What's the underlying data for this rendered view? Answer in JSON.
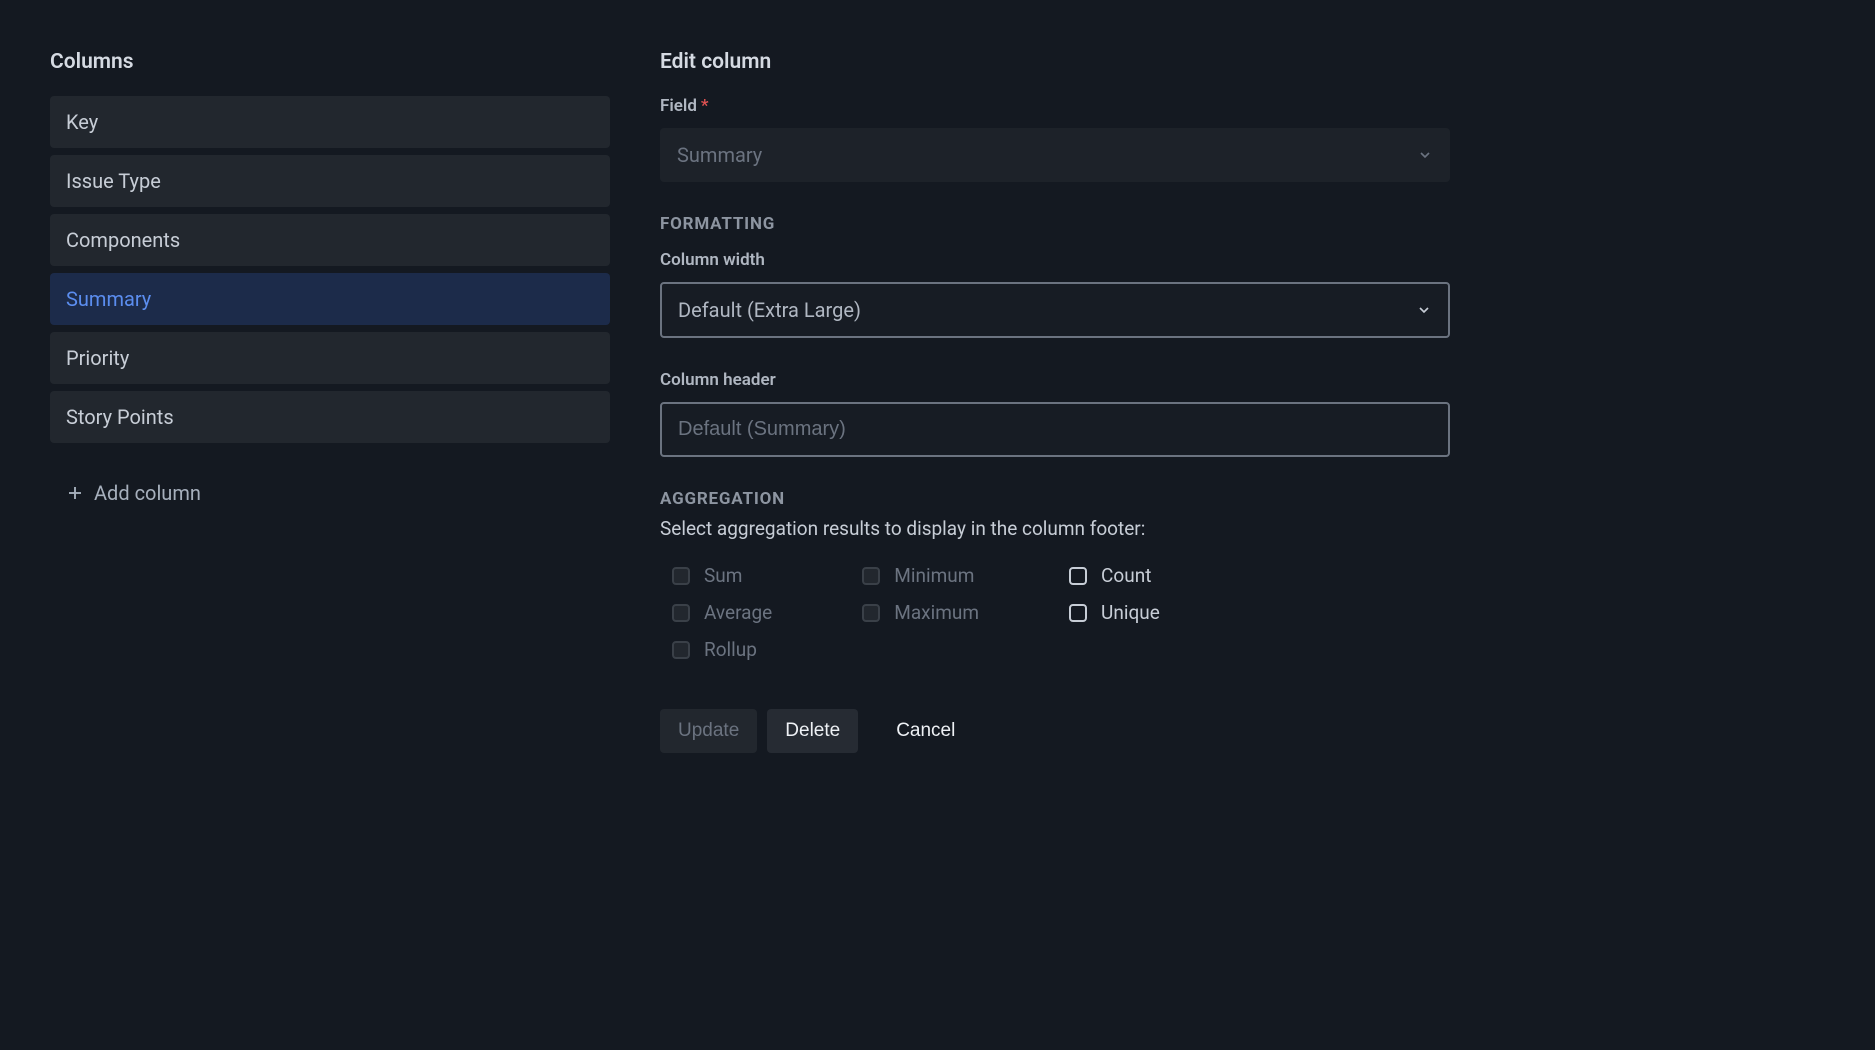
{
  "left": {
    "title": "Columns",
    "items": [
      {
        "label": "Key",
        "selected": false
      },
      {
        "label": "Issue Type",
        "selected": false
      },
      {
        "label": "Components",
        "selected": false
      },
      {
        "label": "Summary",
        "selected": true
      },
      {
        "label": "Priority",
        "selected": false
      },
      {
        "label": "Story Points",
        "selected": false
      }
    ],
    "add_label": "Add column"
  },
  "right": {
    "title": "Edit column",
    "field": {
      "label": "Field",
      "value": "Summary"
    },
    "formatting": {
      "header": "FORMATTING",
      "width": {
        "label": "Column width",
        "value": "Default (Extra Large)"
      },
      "column_header": {
        "label": "Column header",
        "placeholder": "Default (Summary)"
      }
    },
    "aggregation": {
      "header": "AGGREGATION",
      "desc": "Select aggregation results to display in the column footer:",
      "options": [
        {
          "label": "Sum",
          "enabled": false
        },
        {
          "label": "Average",
          "enabled": false
        },
        {
          "label": "Rollup",
          "enabled": false
        },
        {
          "label": "Minimum",
          "enabled": false
        },
        {
          "label": "Maximum",
          "enabled": false
        },
        {
          "label": "Count",
          "enabled": true
        },
        {
          "label": "Unique",
          "enabled": true
        }
      ]
    },
    "buttons": {
      "update": "Update",
      "delete": "Delete",
      "cancel": "Cancel"
    }
  }
}
